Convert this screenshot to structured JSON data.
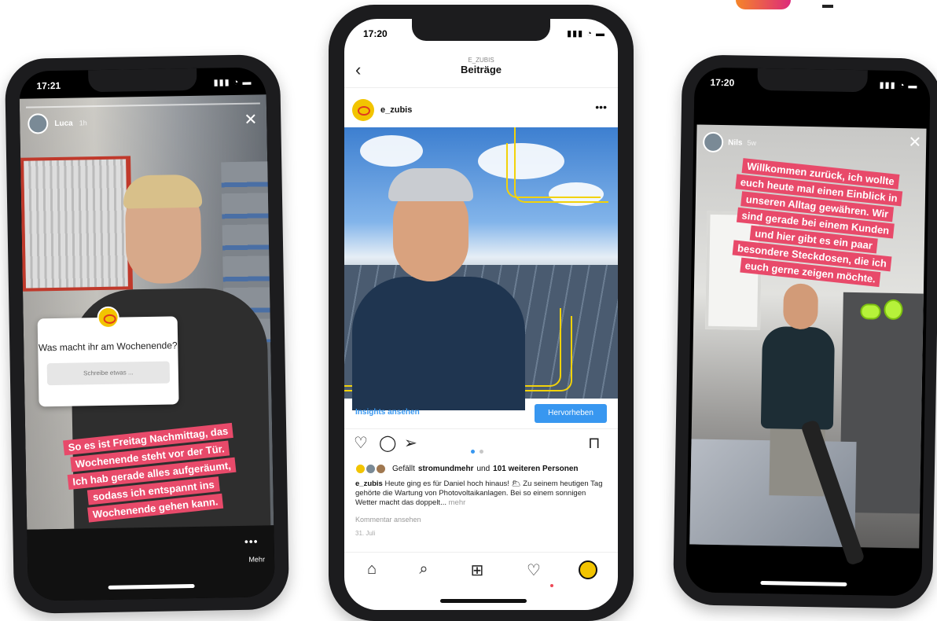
{
  "left_phone": {
    "status_time": "17:21",
    "status_icons": "▮▮▮ ◔ ▬",
    "story_user": "Luca",
    "story_time": "1h",
    "question_title": "Was macht ihr am Wochenende?",
    "question_placeholder": "Schreibe etwas ...",
    "caption_lines": [
      "So es ist Freitag Nachmittag, das",
      "Wochenende steht vor der Tür.",
      "Ich hab gerade alles aufgeräumt,",
      "sodass ich entspannt ins",
      "Wochenende gehen kann."
    ],
    "more_dots": "•••",
    "more_label": "Mehr"
  },
  "center_phone": {
    "status_time": "17:20",
    "status_icons": "▮▮▮ ◔ ▬",
    "header_sub": "E_ZUBIS",
    "header_title": "Beiträge",
    "post_user": "e_zubis",
    "post_menu": "•••",
    "insights_label": "Insights ansehen",
    "promote_label": "Hervorheben",
    "likes_prefix": "Gefällt",
    "likes_user": "stromundmehr",
    "likes_mid": "und",
    "likes_count": "101 weiteren Personen",
    "caption_user": "e_zubis",
    "caption_text": "Heute ging es für Daniel hoch hinaus! 🌥 Zu seinem heutigen Tag gehörte die Wartung von Photovoltaikanlagen. Bei so einem sonnigen Wetter macht das doppelt...",
    "caption_more": "mehr",
    "comments_link": "Kommentar ansehen",
    "post_date": "31. Juli",
    "carousel_position": {
      "current": 1,
      "total": 2
    }
  },
  "right_phone": {
    "status_time": "17:20",
    "status_icons": "▮▮▮ ◔ ▬",
    "story_user": "Nils",
    "story_time": "5w",
    "caption_lines": [
      "Willkommen zurück, ich wollte",
      "euch heute mal einen Einblick in",
      "unseren Alltag gewähren. Wir",
      "sind gerade bei einem Kunden",
      "und hier gibt es ein paar",
      "besondere Steckdosen, die ich",
      "euch gerne zeigen möchte."
    ]
  },
  "colors": {
    "story_highlight": "#e84a6a",
    "instagram_blue": "#3897f0",
    "brand_yellow": "#f2c400",
    "brand_red": "#e03a1e"
  },
  "icons": {
    "back": "chevron-left-icon",
    "heart": "heart-icon",
    "comment": "comment-icon",
    "share": "send-icon",
    "bookmark": "bookmark-icon",
    "home": "home-icon",
    "search": "search-icon",
    "add": "plus-square-icon",
    "activity": "heart-icon",
    "close": "close-icon"
  }
}
